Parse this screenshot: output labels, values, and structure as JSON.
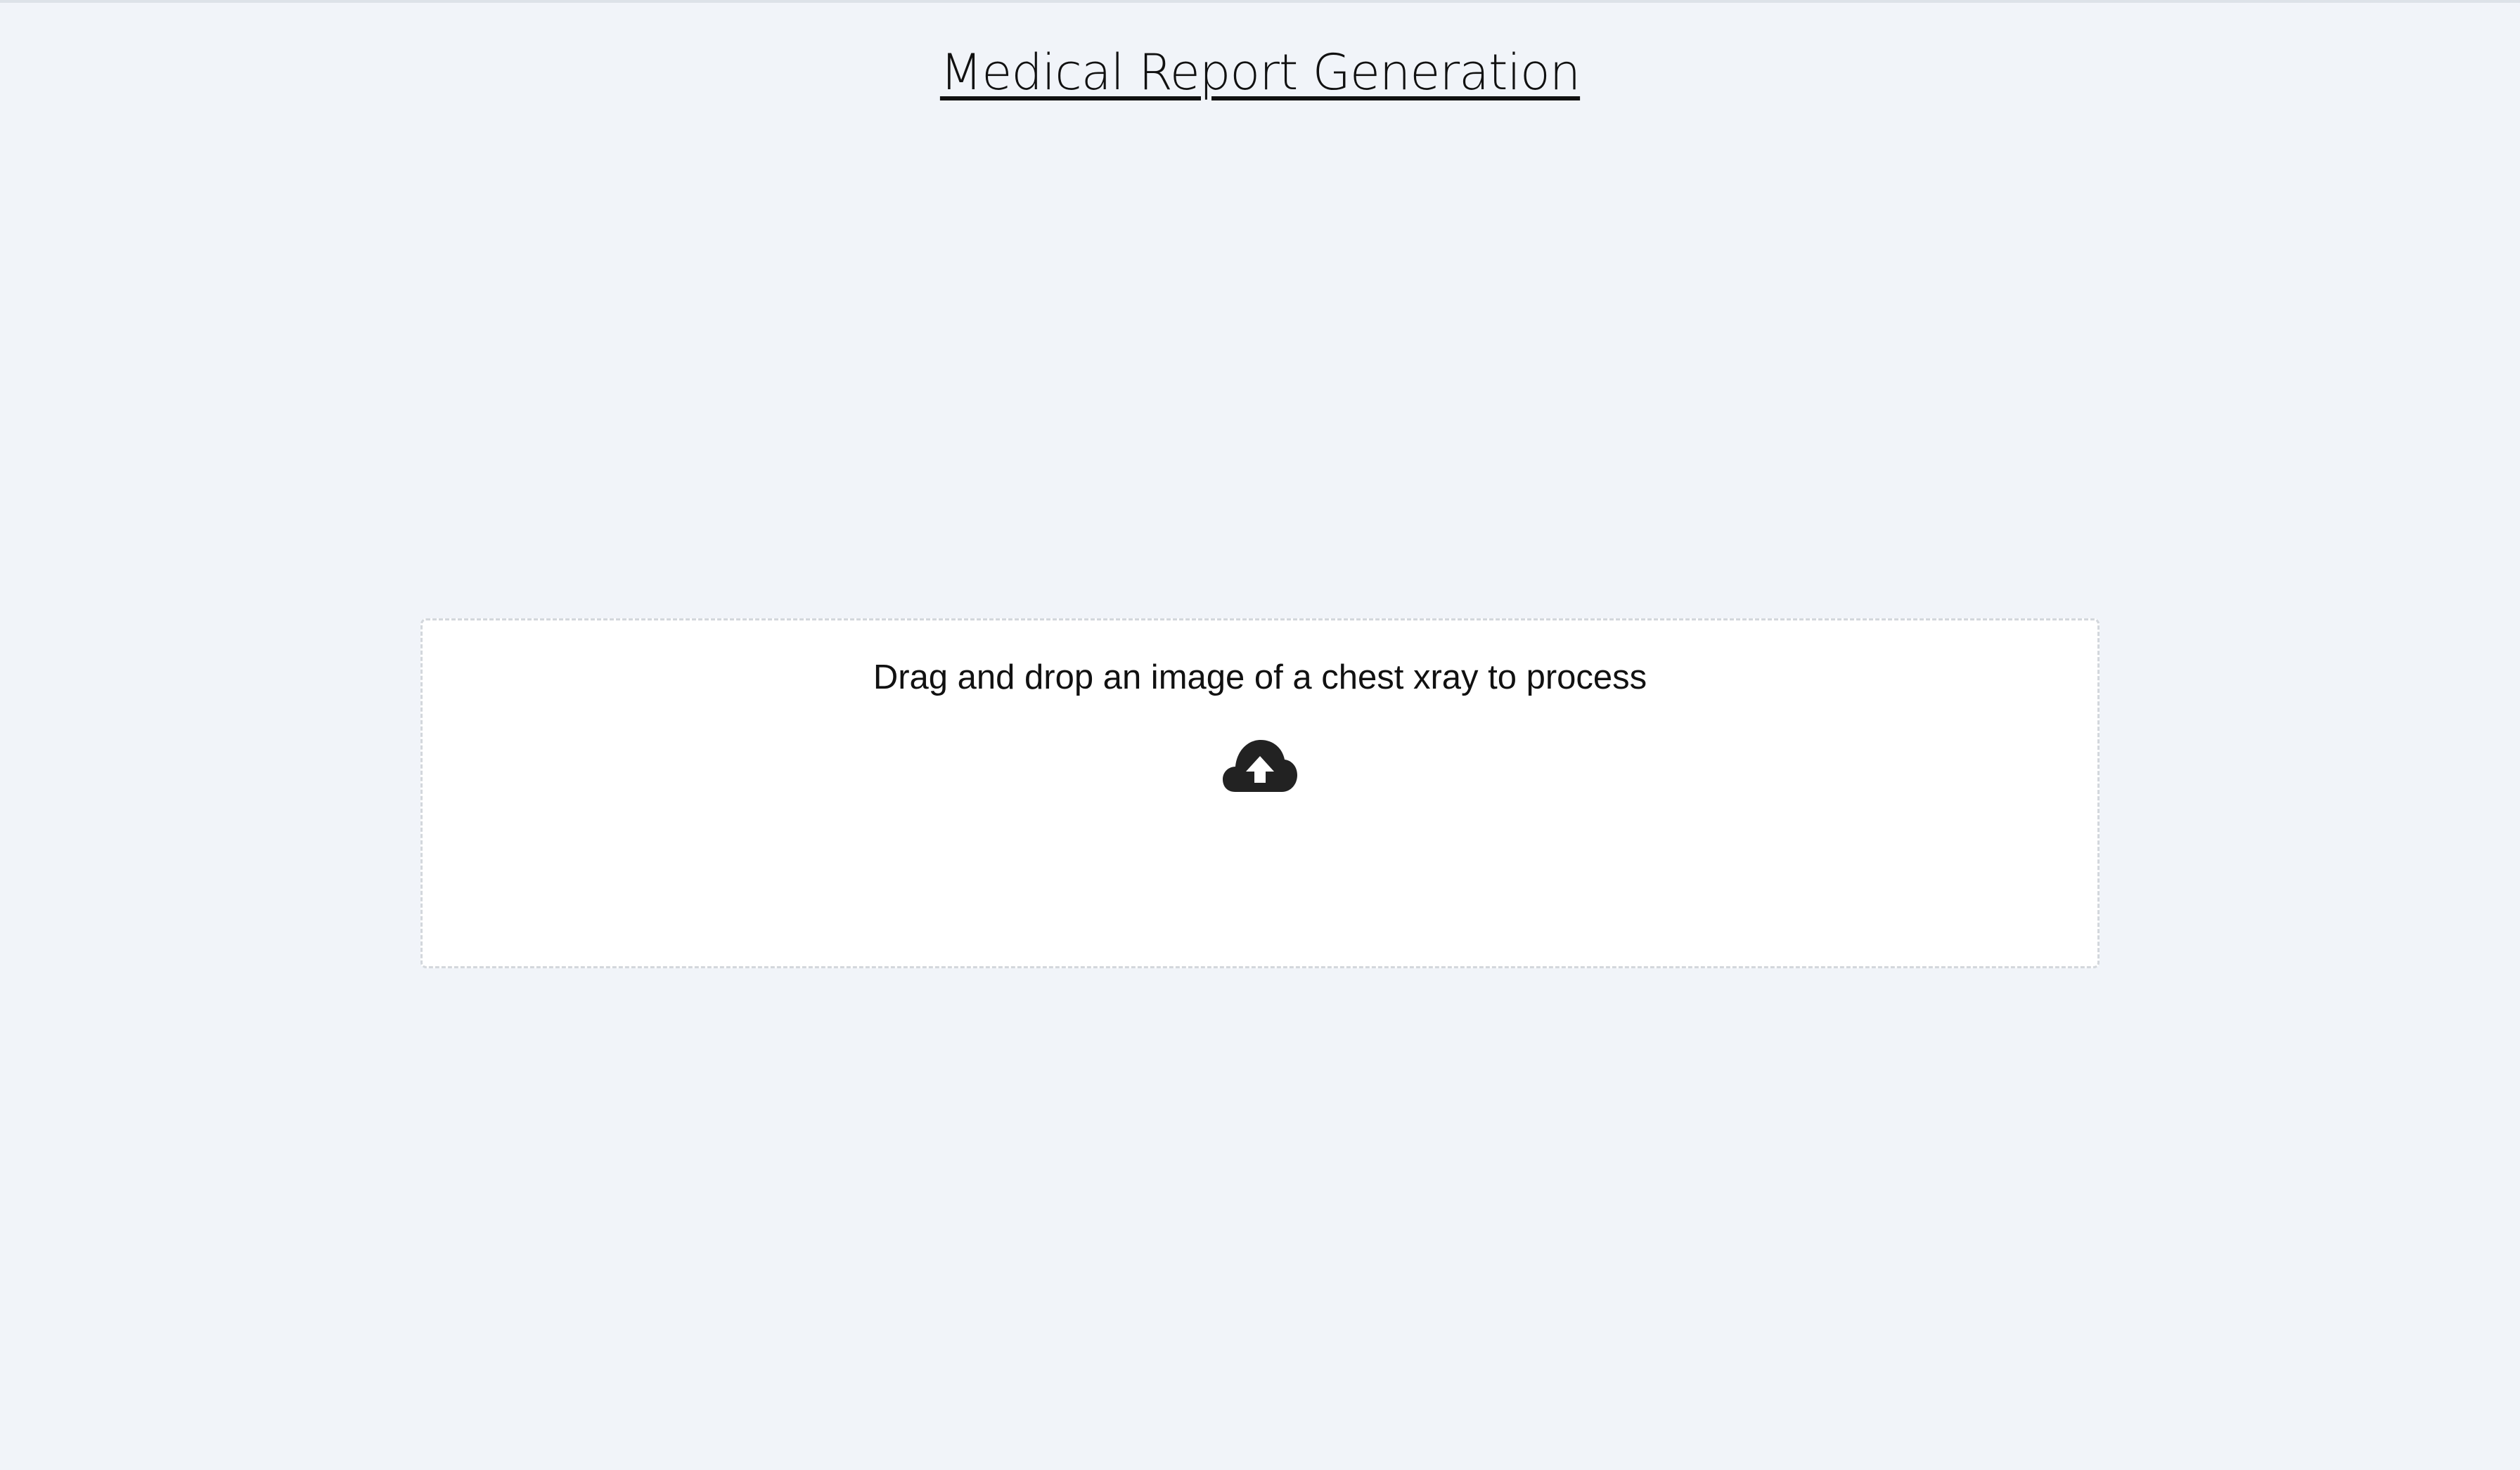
{
  "page": {
    "title": "Medical Report Generation",
    "background_color": "#f1f4f9"
  },
  "upload": {
    "prompt": "Drag and drop an image of a chest xray to process",
    "icon": "cloud-upload-icon",
    "icon_color": "#222222"
  }
}
